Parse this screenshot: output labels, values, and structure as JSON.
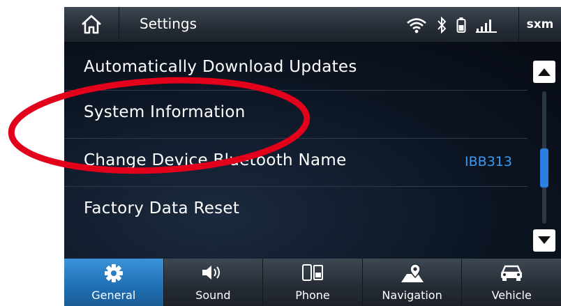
{
  "header": {
    "home_icon": "home-icon",
    "title": "Settings",
    "status_icons": [
      "wifi-icon",
      "bluetooth-icon",
      "battery-icon",
      "signal-icon"
    ],
    "sxm_label": "sxm"
  },
  "settings_list": [
    {
      "label": "Automatically Download Updates",
      "value": ""
    },
    {
      "label": "System Information",
      "value": ""
    },
    {
      "label": "Change Device Bluetooth Name",
      "value": "IBB313"
    },
    {
      "label": "Factory Data Reset",
      "value": ""
    }
  ],
  "tabs": [
    {
      "label": "General",
      "icon": "gear-icon",
      "active": true
    },
    {
      "label": "Sound",
      "icon": "speaker-icon",
      "active": false
    },
    {
      "label": "Phone",
      "icon": "phone-icon",
      "active": false
    },
    {
      "label": "Navigation",
      "icon": "map-pin-icon",
      "active": false
    },
    {
      "label": "Vehicle",
      "icon": "car-icon",
      "active": false
    }
  ],
  "colors": {
    "accent_blue": "#2a7fe0",
    "value_blue": "#3a9bf0",
    "annotation_red": "#e3001b"
  }
}
